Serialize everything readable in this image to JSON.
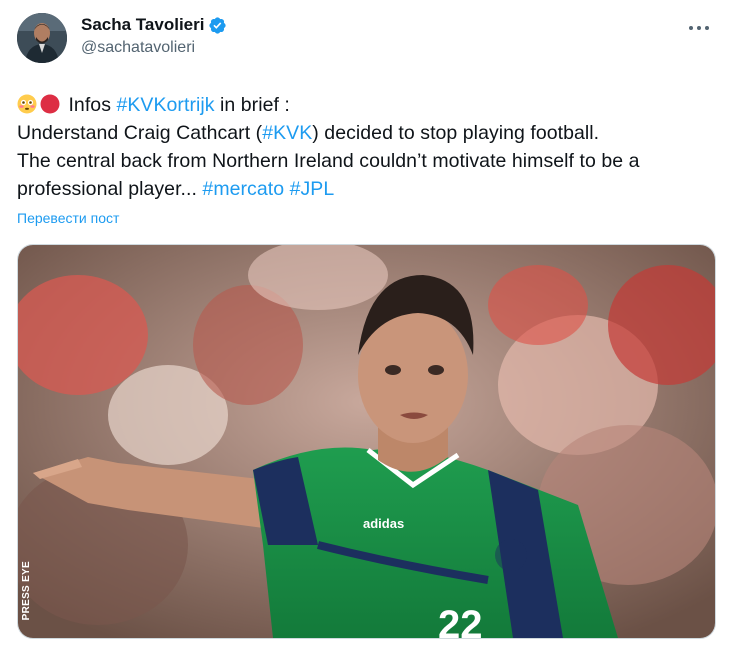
{
  "author": {
    "display_name": "Sacha Tavolieri",
    "handle": "@sachatavolieri",
    "verified": true,
    "avatar_icon": "profile-photo",
    "verified_icon": "verified-badge-icon",
    "more_icon": "more-options-icon"
  },
  "tweet": {
    "line1_prefix": "Infos ",
    "line1_tag": "#KVKortrijk",
    "line1_suffix": " in brief :",
    "line2_prefix": "Understand Craig Cathcart (",
    "line2_tag": "#KVK",
    "line2_suffix": ") decided to stop playing football.",
    "line3": "The central back from Northern Ireland couldn’t motivate himself to be a",
    "line4_prefix": "professional player... ",
    "line4_tag1": "#mercato",
    "line4_space": " ",
    "line4_tag2": "#JPL",
    "emojis": [
      "flushed-face-emoji",
      "red-circle-emoji"
    ]
  },
  "translate_label": "Перевести пост",
  "media": {
    "alt": "football player in green Northern Ireland kit pointing",
    "kit_brand": "adidas",
    "credit": "PRESS EYE"
  },
  "colors": {
    "link": "#1d9bf0",
    "text": "#0f1419",
    "secondary": "#536471",
    "border": "#cfd9de"
  }
}
